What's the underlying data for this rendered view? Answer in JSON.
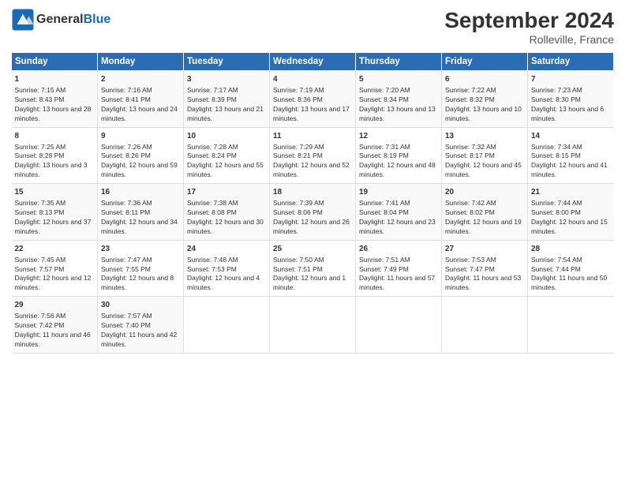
{
  "header": {
    "logo_text_general": "General",
    "logo_text_blue": "Blue",
    "title": "September 2024",
    "subtitle": "Rolleville, France"
  },
  "calendar": {
    "days_of_week": [
      "Sunday",
      "Monday",
      "Tuesday",
      "Wednesday",
      "Thursday",
      "Friday",
      "Saturday"
    ],
    "rows": [
      [
        {
          "day": "1",
          "sunrise": "7:15 AM",
          "sunset": "8:43 PM",
          "daylight": "13 hours and 28 minutes."
        },
        {
          "day": "2",
          "sunrise": "7:16 AM",
          "sunset": "8:41 PM",
          "daylight": "13 hours and 24 minutes."
        },
        {
          "day": "3",
          "sunrise": "7:17 AM",
          "sunset": "8:39 PM",
          "daylight": "13 hours and 21 minutes."
        },
        {
          "day": "4",
          "sunrise": "7:19 AM",
          "sunset": "8:36 PM",
          "daylight": "13 hours and 17 minutes."
        },
        {
          "day": "5",
          "sunrise": "7:20 AM",
          "sunset": "8:34 PM",
          "daylight": "13 hours and 13 minutes."
        },
        {
          "day": "6",
          "sunrise": "7:22 AM",
          "sunset": "8:32 PM",
          "daylight": "13 hours and 10 minutes."
        },
        {
          "day": "7",
          "sunrise": "7:23 AM",
          "sunset": "8:30 PM",
          "daylight": "13 hours and 6 minutes."
        }
      ],
      [
        {
          "day": "8",
          "sunrise": "7:25 AM",
          "sunset": "8:28 PM",
          "daylight": "13 hours and 3 minutes."
        },
        {
          "day": "9",
          "sunrise": "7:26 AM",
          "sunset": "8:26 PM",
          "daylight": "12 hours and 59 minutes."
        },
        {
          "day": "10",
          "sunrise": "7:28 AM",
          "sunset": "8:24 PM",
          "daylight": "12 hours and 55 minutes."
        },
        {
          "day": "11",
          "sunrise": "7:29 AM",
          "sunset": "8:21 PM",
          "daylight": "12 hours and 52 minutes."
        },
        {
          "day": "12",
          "sunrise": "7:31 AM",
          "sunset": "8:19 PM",
          "daylight": "12 hours and 48 minutes."
        },
        {
          "day": "13",
          "sunrise": "7:32 AM",
          "sunset": "8:17 PM",
          "daylight": "12 hours and 45 minutes."
        },
        {
          "day": "14",
          "sunrise": "7:34 AM",
          "sunset": "8:15 PM",
          "daylight": "12 hours and 41 minutes."
        }
      ],
      [
        {
          "day": "15",
          "sunrise": "7:35 AM",
          "sunset": "8:13 PM",
          "daylight": "12 hours and 37 minutes."
        },
        {
          "day": "16",
          "sunrise": "7:36 AM",
          "sunset": "8:11 PM",
          "daylight": "12 hours and 34 minutes."
        },
        {
          "day": "17",
          "sunrise": "7:38 AM",
          "sunset": "8:08 PM",
          "daylight": "12 hours and 30 minutes."
        },
        {
          "day": "18",
          "sunrise": "7:39 AM",
          "sunset": "8:06 PM",
          "daylight": "12 hours and 26 minutes."
        },
        {
          "day": "19",
          "sunrise": "7:41 AM",
          "sunset": "8:04 PM",
          "daylight": "12 hours and 23 minutes."
        },
        {
          "day": "20",
          "sunrise": "7:42 AM",
          "sunset": "8:02 PM",
          "daylight": "12 hours and 19 minutes."
        },
        {
          "day": "21",
          "sunrise": "7:44 AM",
          "sunset": "8:00 PM",
          "daylight": "12 hours and 15 minutes."
        }
      ],
      [
        {
          "day": "22",
          "sunrise": "7:45 AM",
          "sunset": "7:57 PM",
          "daylight": "12 hours and 12 minutes."
        },
        {
          "day": "23",
          "sunrise": "7:47 AM",
          "sunset": "7:55 PM",
          "daylight": "12 hours and 8 minutes."
        },
        {
          "day": "24",
          "sunrise": "7:48 AM",
          "sunset": "7:53 PM",
          "daylight": "12 hours and 4 minutes."
        },
        {
          "day": "25",
          "sunrise": "7:50 AM",
          "sunset": "7:51 PM",
          "daylight": "12 hours and 1 minute."
        },
        {
          "day": "26",
          "sunrise": "7:51 AM",
          "sunset": "7:49 PM",
          "daylight": "11 hours and 57 minutes."
        },
        {
          "day": "27",
          "sunrise": "7:53 AM",
          "sunset": "7:47 PM",
          "daylight": "11 hours and 53 minutes."
        },
        {
          "day": "28",
          "sunrise": "7:54 AM",
          "sunset": "7:44 PM",
          "daylight": "11 hours and 50 minutes."
        }
      ],
      [
        {
          "day": "29",
          "sunrise": "7:56 AM",
          "sunset": "7:42 PM",
          "daylight": "11 hours and 46 minutes."
        },
        {
          "day": "30",
          "sunrise": "7:57 AM",
          "sunset": "7:40 PM",
          "daylight": "11 hours and 42 minutes."
        },
        null,
        null,
        null,
        null,
        null
      ]
    ]
  }
}
